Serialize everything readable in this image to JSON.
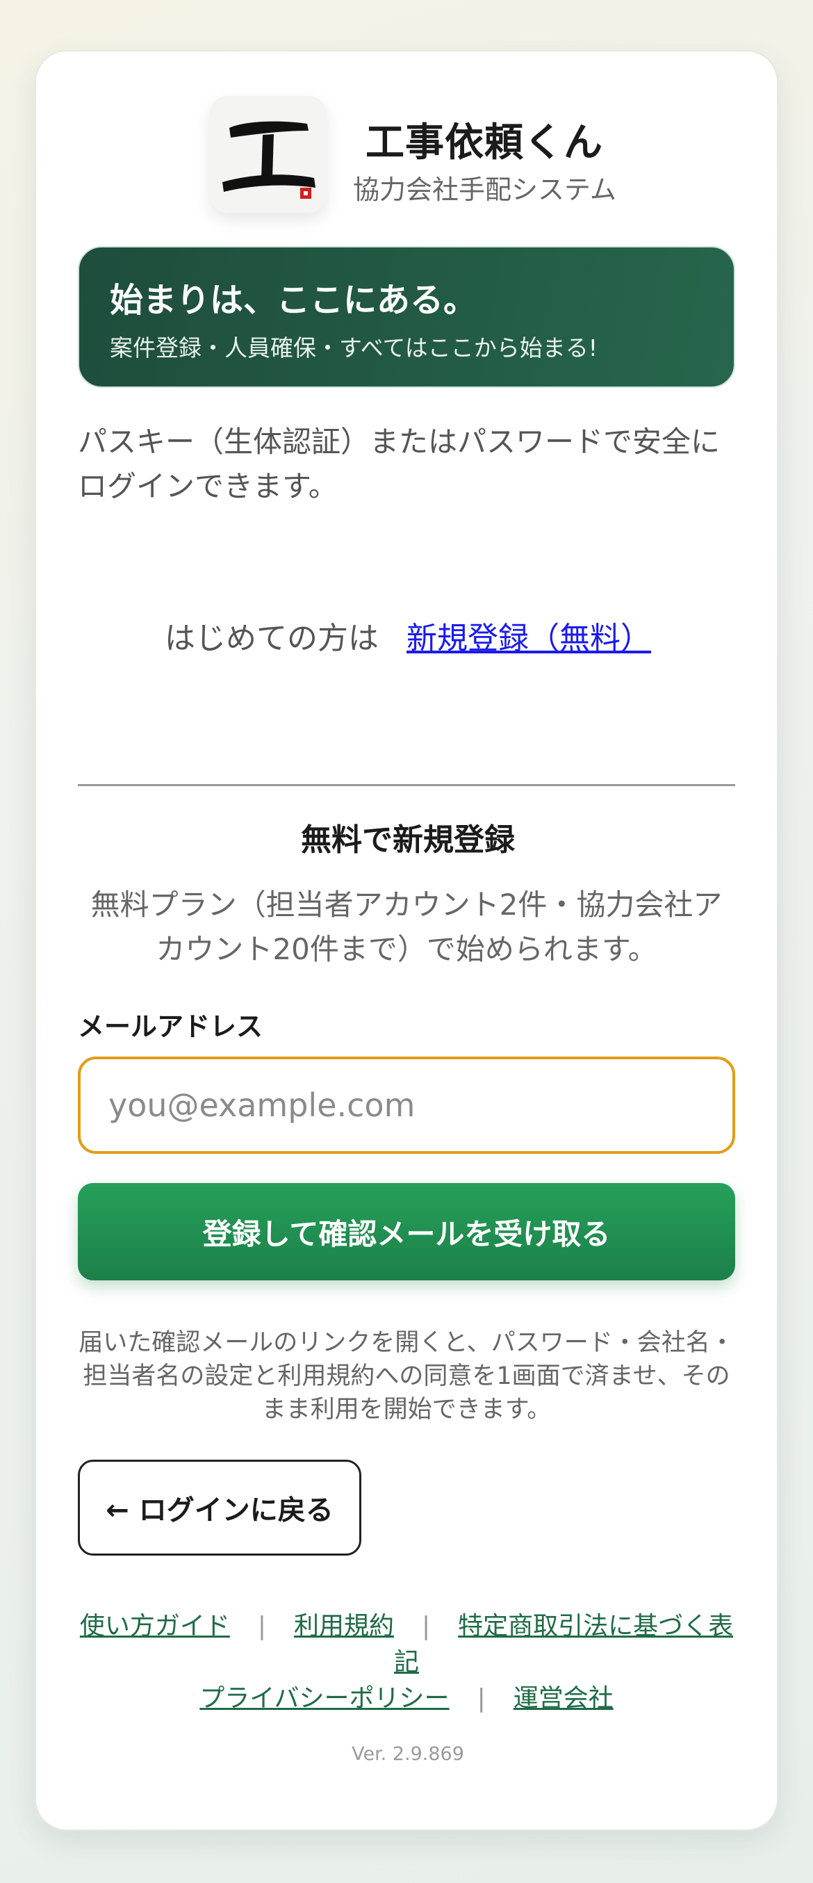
{
  "brand": {
    "app_name": "工事依頼くん",
    "subtitle": "協力会社手配システム",
    "logo_icon": "kou-brush-calligraphy-logo"
  },
  "hero": {
    "title": "始まりは、ここにある。",
    "subtitle": "案件登録・人員確保・すべてはここから始まる!"
  },
  "intro": "パスキー（生体認証）またはパスワードで安全にログインできます。",
  "first_time": {
    "prefix": "はじめての方は",
    "link": "新規登録（無料）"
  },
  "register": {
    "title": "無料で新規登録",
    "description": "無料プラン（担当者アカウント2件・協力会社アカウント20件まで）で始められます。",
    "email_label": "メールアドレス",
    "email_placeholder": "you@example.com",
    "email_value": "",
    "submit_label": "登録して確認メールを受け取る",
    "note": "届いた確認メールのリンクを開くと、パスワード・会社名・担当者名の設定と利用規約への同意を1画面で済ませ、そのまま利用を開始できます。"
  },
  "back_button": "← ログインに戻る",
  "footer": {
    "links": [
      "使い方ガイド",
      "利用規約",
      "特定商取引法に基づく表記",
      "プライバシーポリシー",
      "運営会社"
    ],
    "separator": "|"
  },
  "version": "Ver. 2.9.869",
  "colors": {
    "brand_green": "#235c45",
    "button_green": "#1c8049",
    "input_focus": "#e39c17",
    "link_blue": "#1a1aee",
    "footer_link": "#1f6b45"
  }
}
